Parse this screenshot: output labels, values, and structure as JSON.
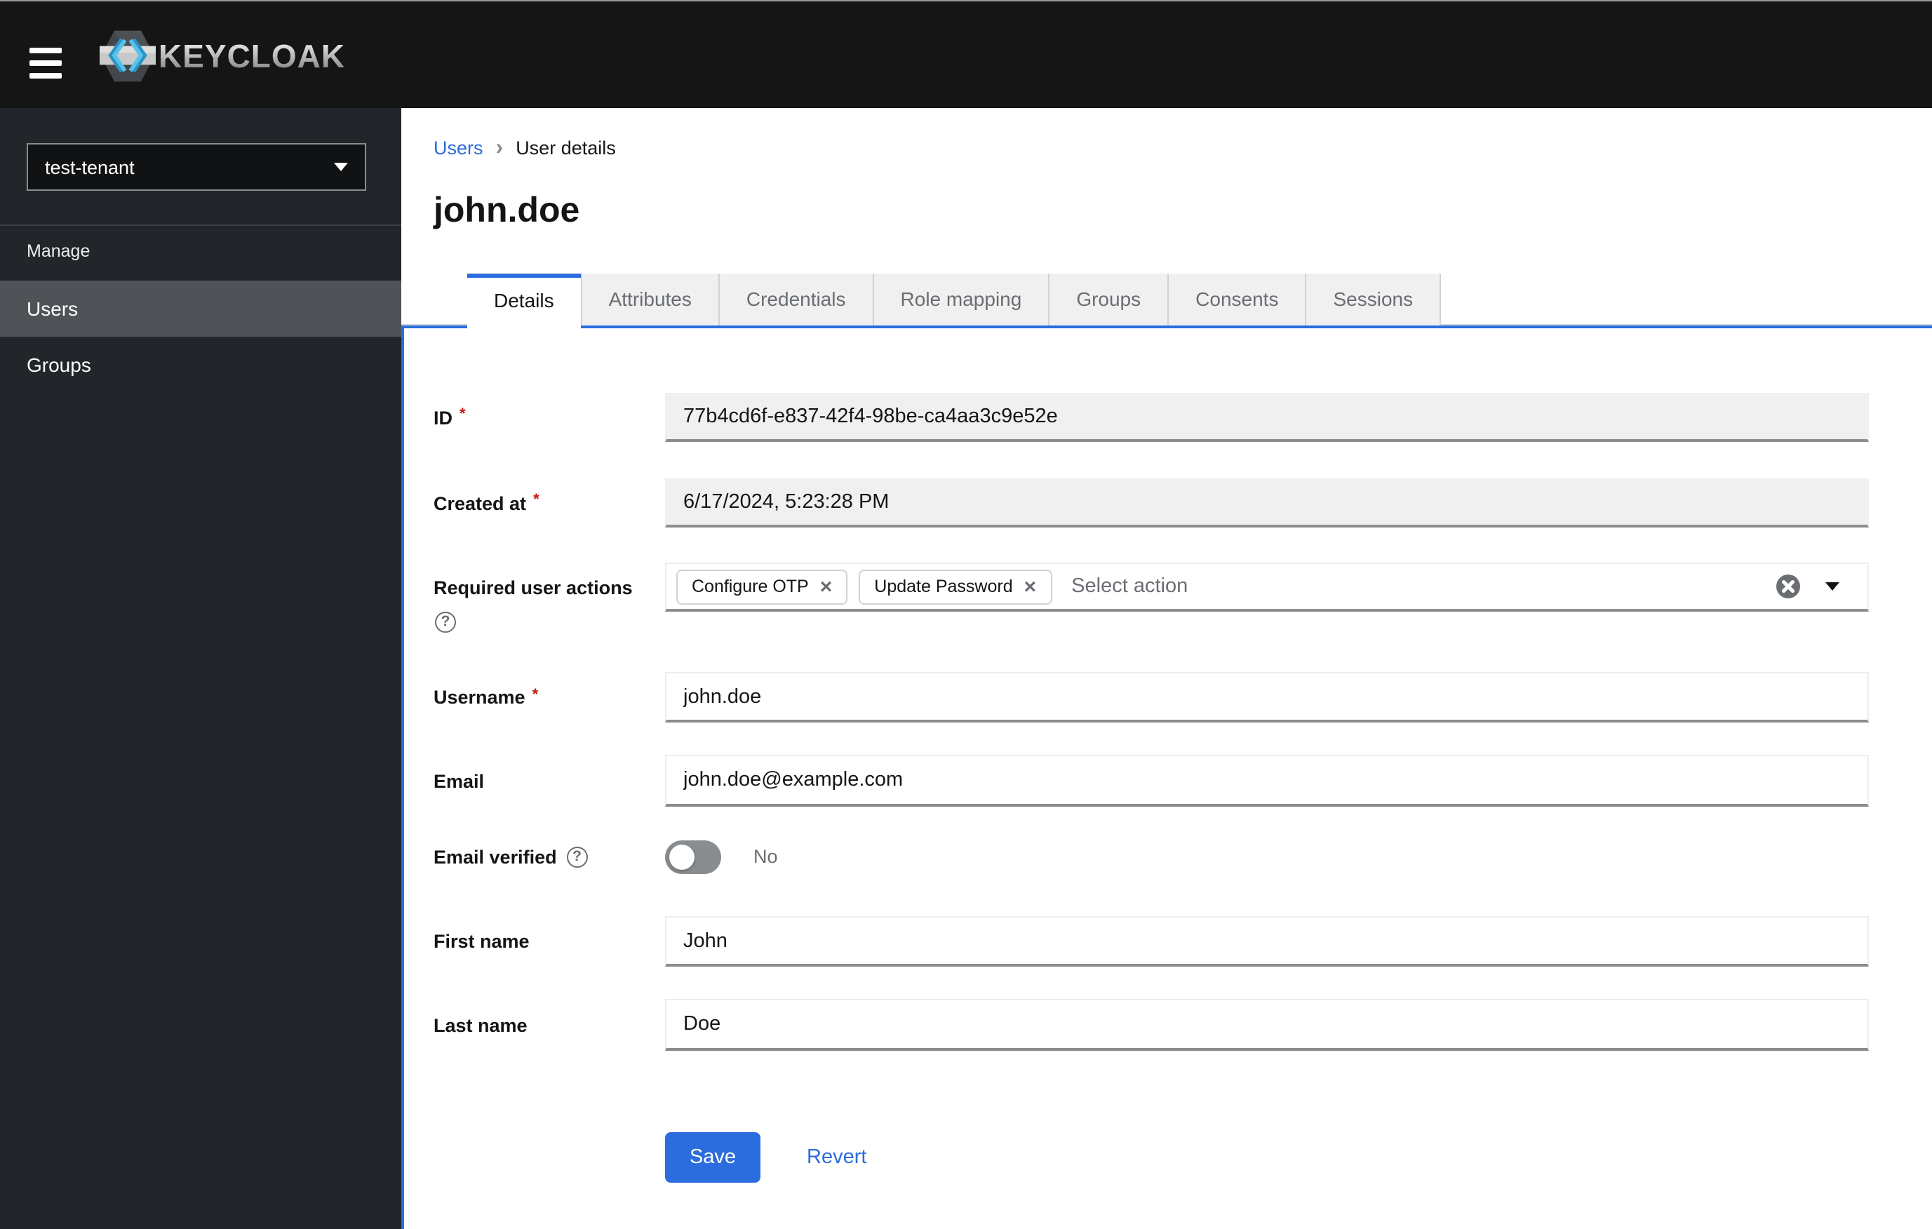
{
  "colors": {
    "primary_blue": "#2b6cde",
    "topbar_bg": "#151515",
    "sidebar_bg": "#222529",
    "sidebar_active_bg": "#4f5357",
    "tab_inactive_bg": "#f0f0f0",
    "input_disabled_bg": "#f0f0f0",
    "input_bottom_border": "#8a8d90",
    "muted_text": "#6a6e73",
    "required_red": "#c9190b"
  },
  "icons": {
    "breadcrumb_separator": "›",
    "help": "?",
    "chip_close": "×"
  },
  "topbar": {
    "brand_text": "KEYCLOAK"
  },
  "sidebar": {
    "realm_selector": {
      "value": "test-tenant"
    },
    "section_label": "Manage",
    "items": [
      {
        "label": "Users",
        "active": true
      },
      {
        "label": "Groups",
        "active": false
      }
    ]
  },
  "breadcrumb": {
    "items": [
      {
        "label": "Users",
        "is_link": true
      },
      {
        "label": "User details",
        "is_link": false
      }
    ]
  },
  "page_title": "john.doe",
  "tabs": [
    {
      "label": "Details",
      "active": true
    },
    {
      "label": "Attributes",
      "active": false
    },
    {
      "label": "Credentials",
      "active": false
    },
    {
      "label": "Role mapping",
      "active": false
    },
    {
      "label": "Groups",
      "active": false
    },
    {
      "label": "Consents",
      "active": false
    },
    {
      "label": "Sessions",
      "active": false
    }
  ],
  "form": {
    "required_marker": "*",
    "id": {
      "label": "ID",
      "required": true,
      "disabled": true,
      "value": "77b4cd6f-e837-42f4-98be-ca4aa3c9e52e"
    },
    "created_at": {
      "label": "Created at",
      "required": true,
      "disabled": true,
      "value": "6/17/2024, 5:23:28 PM"
    },
    "required_user_actions": {
      "label": "Required user actions",
      "chips": [
        {
          "label": "Configure OTP"
        },
        {
          "label": "Update Password"
        }
      ],
      "placeholder": "Select action"
    },
    "username": {
      "label": "Username",
      "required": true,
      "value": "john.doe"
    },
    "email": {
      "label": "Email",
      "value": "john.doe@example.com"
    },
    "email_verified": {
      "label": "Email verified",
      "value": "No",
      "checked": false
    },
    "first_name": {
      "label": "First name",
      "value": "John"
    },
    "last_name": {
      "label": "Last name",
      "value": "Doe"
    }
  },
  "actions": {
    "save_label": "Save",
    "revert_label": "Revert"
  }
}
